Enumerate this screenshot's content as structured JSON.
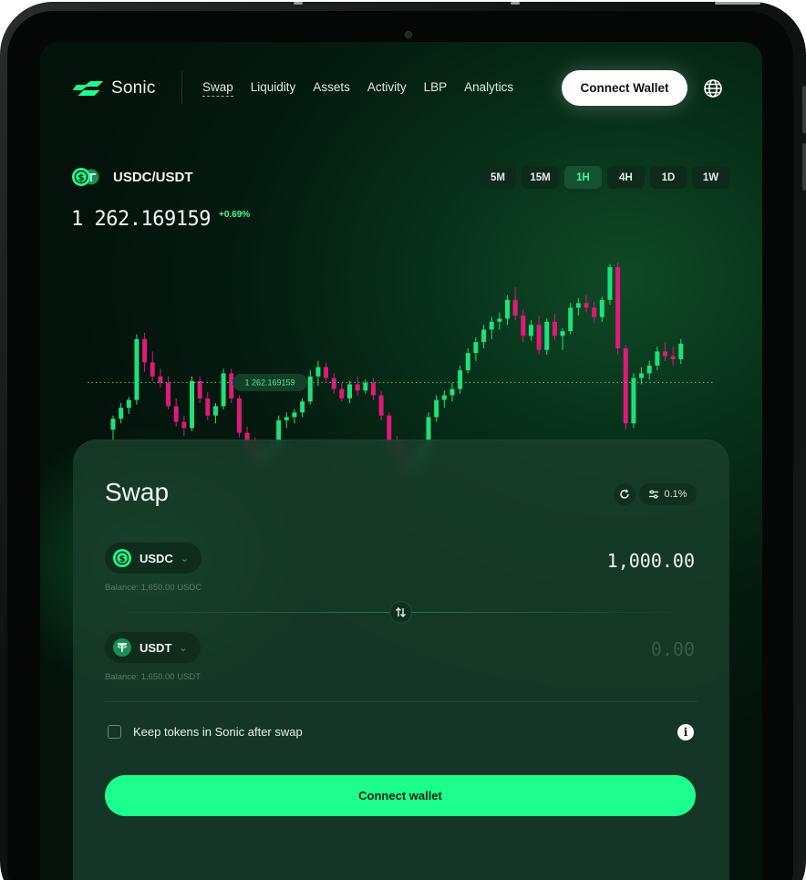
{
  "brand": {
    "name": "Sonic"
  },
  "nav": {
    "items": [
      {
        "label": "Swap",
        "active": true
      },
      {
        "label": "Liquidity",
        "active": false
      },
      {
        "label": "Assets",
        "active": false
      },
      {
        "label": "Activity",
        "active": false
      },
      {
        "label": "LBP",
        "active": false
      },
      {
        "label": "Analytics",
        "active": false
      }
    ],
    "connect_label": "Connect Wallet",
    "language_icon": "globe-icon"
  },
  "market": {
    "pair": "USDC/USDT",
    "timeframes": [
      "5M",
      "15M",
      "1H",
      "4H",
      "1D",
      "1W"
    ],
    "active_timeframe": "1H",
    "price": "1 262.169159",
    "change": "+0.69%",
    "price_marker": "1 262.169159"
  },
  "swap": {
    "title": "Swap",
    "slippage": "0.1%",
    "from": {
      "symbol": "USDC",
      "amount": "1,000.00",
      "balance": "Balance: 1,650.00 USDC"
    },
    "to": {
      "symbol": "USDT",
      "amount": "0.00",
      "balance": "Balance: 1,650.00 USDT"
    },
    "keep_tokens_label": "Keep tokens in Sonic after swap",
    "keep_tokens_checked": false,
    "connect_label": "Connect wallet"
  },
  "colors": {
    "accent": "#1dff8c",
    "candle_up": "#1fe07a",
    "candle_down": "#e0197a",
    "background": "#041a0f"
  },
  "chart_data": {
    "type": "candlestick",
    "candles": [
      [
        1232,
        1241,
        1225,
        1239
      ],
      [
        1239,
        1249,
        1236,
        1246
      ],
      [
        1246,
        1253,
        1242,
        1251
      ],
      [
        1251,
        1293,
        1248,
        1290
      ],
      [
        1290,
        1294,
        1269,
        1275
      ],
      [
        1275,
        1282,
        1263,
        1266
      ],
      [
        1266,
        1271,
        1259,
        1262
      ],
      [
        1262,
        1266,
        1245,
        1247
      ],
      [
        1247,
        1252,
        1234,
        1237
      ],
      [
        1237,
        1241,
        1228,
        1233
      ],
      [
        1233,
        1266,
        1231,
        1263
      ],
      [
        1263,
        1266,
        1249,
        1252
      ],
      [
        1252,
        1256,
        1238,
        1241
      ],
      [
        1241,
        1249,
        1236,
        1247
      ],
      [
        1247,
        1271,
        1245,
        1268
      ],
      [
        1268,
        1271,
        1249,
        1252
      ],
      [
        1252,
        1254,
        1227,
        1230
      ],
      [
        1230,
        1234,
        1218,
        1222
      ],
      [
        1222,
        1227,
        1208,
        1213
      ],
      [
        1213,
        1221,
        1209,
        1218
      ],
      [
        1218,
        1225,
        1214,
        1221
      ],
      [
        1221,
        1241,
        1219,
        1238
      ],
      [
        1238,
        1243,
        1233,
        1240
      ],
      [
        1240,
        1245,
        1236,
        1243
      ],
      [
        1243,
        1252,
        1240,
        1250
      ],
      [
        1250,
        1270,
        1248,
        1266
      ],
      [
        1266,
        1276,
        1260,
        1272
      ],
      [
        1272,
        1275,
        1262,
        1265
      ],
      [
        1265,
        1268,
        1255,
        1258
      ],
      [
        1258,
        1262,
        1250,
        1252
      ],
      [
        1252,
        1263,
        1249,
        1261
      ],
      [
        1261,
        1266,
        1254,
        1257
      ],
      [
        1257,
        1264,
        1255,
        1262
      ],
      [
        1262,
        1265,
        1251,
        1254
      ],
      [
        1254,
        1257,
        1238,
        1241
      ],
      [
        1241,
        1243,
        1221,
        1224
      ],
      [
        1224,
        1228,
        1215,
        1218
      ],
      [
        1218,
        1222,
        1206,
        1209
      ],
      [
        1209,
        1214,
        1203,
        1211
      ],
      [
        1211,
        1223,
        1208,
        1220
      ],
      [
        1220,
        1243,
        1218,
        1240
      ],
      [
        1240,
        1254,
        1237,
        1251
      ],
      [
        1251,
        1257,
        1246,
        1254
      ],
      [
        1254,
        1262,
        1250,
        1258
      ],
      [
        1258,
        1273,
        1255,
        1270
      ],
      [
        1270,
        1284,
        1268,
        1281
      ],
      [
        1281,
        1291,
        1276,
        1288
      ],
      [
        1288,
        1299,
        1284,
        1296
      ],
      [
        1296,
        1304,
        1290,
        1301
      ],
      [
        1301,
        1307,
        1296,
        1303
      ],
      [
        1303,
        1318,
        1299,
        1315
      ],
      [
        1315,
        1323,
        1302,
        1305
      ],
      [
        1305,
        1309,
        1288,
        1292
      ],
      [
        1292,
        1302,
        1289,
        1299
      ],
      [
        1299,
        1305,
        1280,
        1283
      ],
      [
        1283,
        1303,
        1280,
        1301
      ],
      [
        1301,
        1306,
        1289,
        1292
      ],
      [
        1292,
        1297,
        1283,
        1295
      ],
      [
        1295,
        1313,
        1293,
        1310
      ],
      [
        1310,
        1316,
        1305,
        1313
      ],
      [
        1313,
        1318,
        1307,
        1310
      ],
      [
        1310,
        1314,
        1300,
        1304
      ],
      [
        1304,
        1317,
        1301,
        1315
      ],
      [
        1315,
        1338,
        1312,
        1336
      ],
      [
        1336,
        1339,
        1280,
        1284
      ],
      [
        1284,
        1286,
        1232,
        1236
      ],
      [
        1236,
        1268,
        1233,
        1265
      ],
      [
        1265,
        1272,
        1261,
        1268
      ],
      [
        1268,
        1276,
        1264,
        1273
      ],
      [
        1273,
        1285,
        1270,
        1282
      ],
      [
        1282,
        1288,
        1276,
        1279
      ],
      [
        1279,
        1285,
        1273,
        1277
      ],
      [
        1277,
        1290,
        1274,
        1287
      ]
    ],
    "reference_price": 1262.169159,
    "ylim": [
      1200,
      1340
    ]
  }
}
